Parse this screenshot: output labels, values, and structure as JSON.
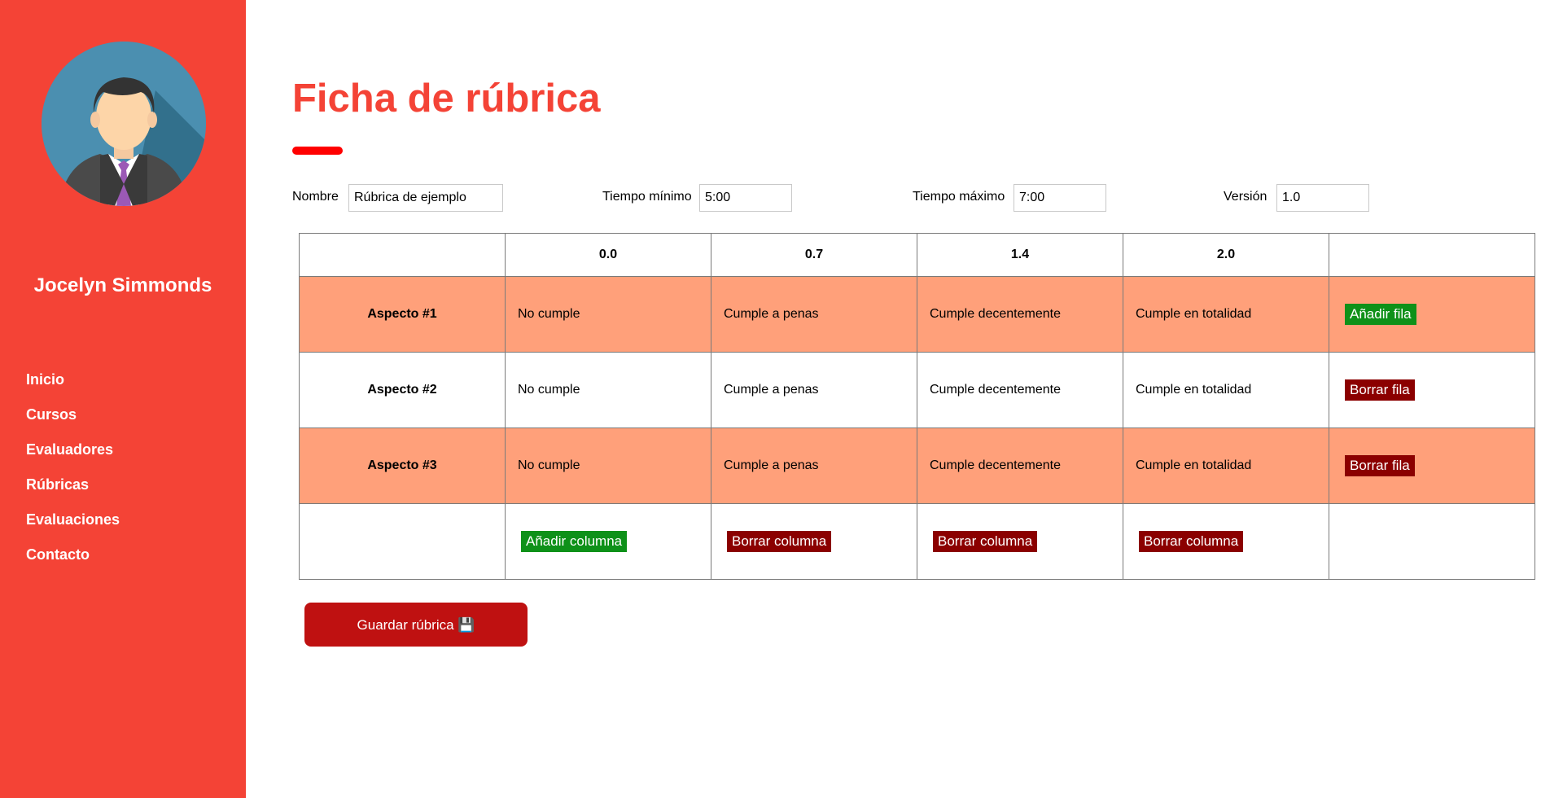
{
  "sidebar": {
    "user_name": "Jocelyn Simmonds",
    "nav": [
      "Inicio",
      "Cursos",
      "Evaluadores",
      "Rúbricas",
      "Evaluaciones",
      "Contacto"
    ]
  },
  "page": {
    "title": "Ficha de rúbrica"
  },
  "form": {
    "nombre_label": "Nombre",
    "nombre_value": "Rúbrica de ejemplo",
    "tmin_label": "Tiempo mínimo",
    "tmin_value": "5:00",
    "tmax_label": "Tiempo máximo",
    "tmax_value": "7:00",
    "version_label": "Versión",
    "version_value": "1.0"
  },
  "rubric": {
    "levels": [
      "0.0",
      "0.7",
      "1.4",
      "2.0"
    ],
    "rows": [
      {
        "aspect": "Aspecto #1",
        "cells": [
          "No cumple",
          "Cumple a penas",
          "Cumple decentemente",
          "Cumple en totalidad"
        ],
        "action": "Añadir fila"
      },
      {
        "aspect": "Aspecto #2",
        "cells": [
          "No cumple",
          "Cumple a penas",
          "Cumple decentemente",
          "Cumple en totalidad"
        ],
        "action": "Borrar fila"
      },
      {
        "aspect": "Aspecto #3",
        "cells": [
          "No cumple",
          "Cumple a penas",
          "Cumple decentemente",
          "Cumple en totalidad"
        ],
        "action": "Borrar fila"
      }
    ],
    "column_actions": [
      "Añadir columna",
      "Borrar columna",
      "Borrar columna",
      "Borrar columna"
    ]
  },
  "save_button": "Guardar rúbrica 💾",
  "colors": {
    "sidebar": "#f44336",
    "title": "#f44336",
    "row_alt": "#ffa07a",
    "add_button": "#0e9119",
    "delete_button": "#8b0000",
    "save_button": "#bf1111"
  },
  "icons": {
    "avatar": "businessman-avatar-icon",
    "save": "floppy-disk-icon"
  }
}
